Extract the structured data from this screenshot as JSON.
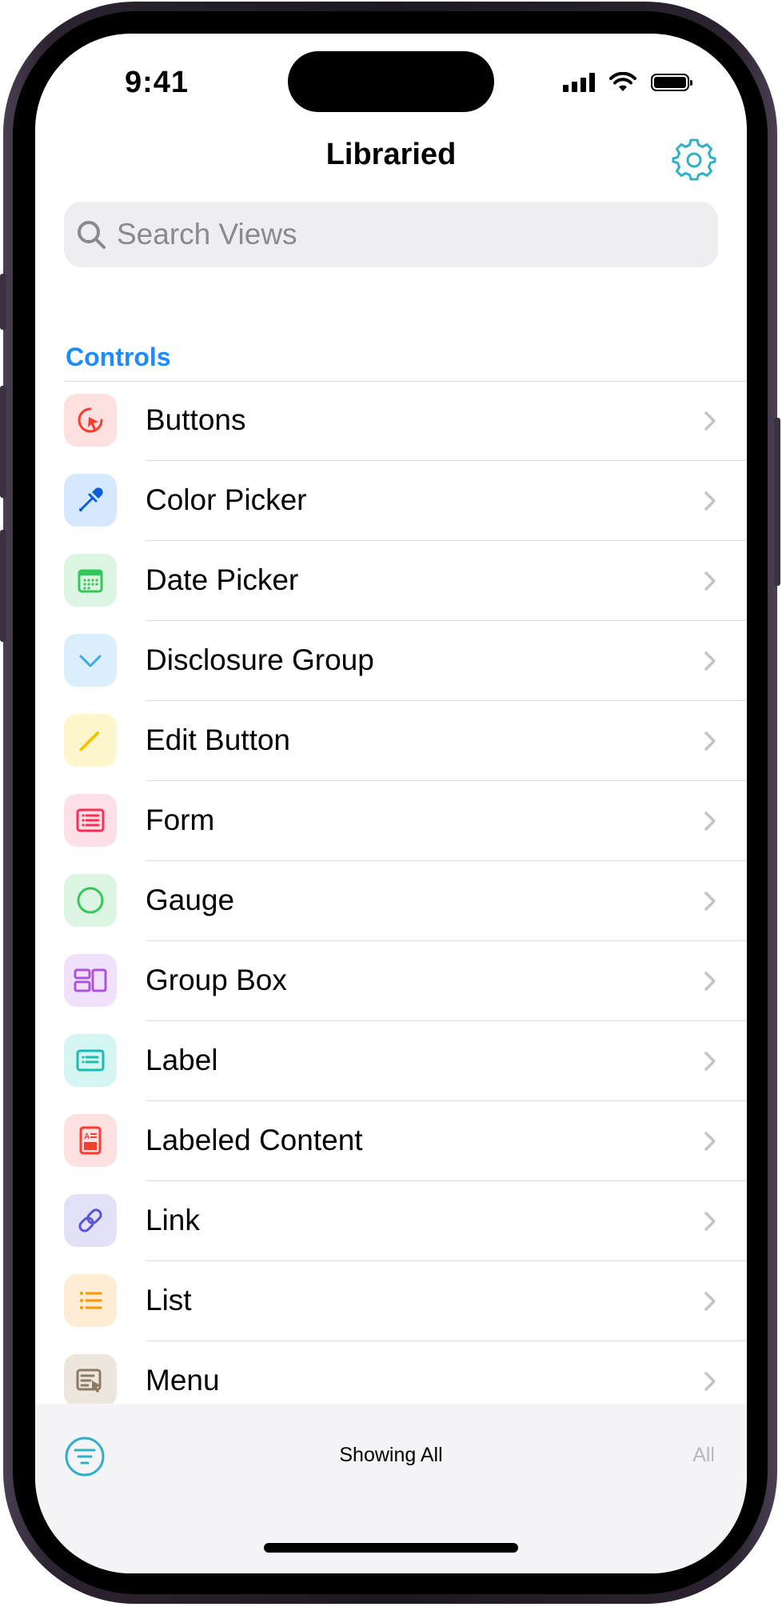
{
  "status_bar": {
    "time": "9:41"
  },
  "nav": {
    "title": "Libraried"
  },
  "search": {
    "placeholder": "Search Views",
    "value": ""
  },
  "section": {
    "title": "Controls"
  },
  "items": [
    {
      "label": "Buttons",
      "icon": "cursor-click-icon",
      "color": "#ff3b30",
      "bg": "#fde1e0"
    },
    {
      "label": "Color Picker",
      "icon": "eyedropper-icon",
      "color": "#0a60d6",
      "bg": "#d6e8fd"
    },
    {
      "label": "Date Picker",
      "icon": "calendar-icon",
      "color": "#34c759",
      "bg": "#dcf4e2"
    },
    {
      "label": "Disclosure Group",
      "icon": "chevron-down-icon",
      "color": "#32ade6",
      "bg": "#dbeefb"
    },
    {
      "label": "Edit Button",
      "icon": "pencil-icon",
      "color": "#f5c400",
      "bg": "#fdf6cc"
    },
    {
      "label": "Form",
      "icon": "form-icon",
      "color": "#ff2d55",
      "bg": "#fde0e6"
    },
    {
      "label": "Gauge",
      "icon": "circle-icon",
      "color": "#34c759",
      "bg": "#dcf4e2"
    },
    {
      "label": "Group Box",
      "icon": "group-box-icon",
      "color": "#af52de",
      "bg": "#f0e0fa"
    },
    {
      "label": "Label",
      "icon": "label-card-icon",
      "color": "#17bdb0",
      "bg": "#d5f5f3"
    },
    {
      "label": "Labeled Content",
      "icon": "labeled-content-icon",
      "color": "#ff3b30",
      "bg": "#fde1e0"
    },
    {
      "label": "Link",
      "icon": "link-icon",
      "color": "#5856d6",
      "bg": "#e2e1f8"
    },
    {
      "label": "List",
      "icon": "list-bullet-icon",
      "color": "#ff9500",
      "bg": "#feecd4"
    },
    {
      "label": "Menu",
      "icon": "menu-pointer-icon",
      "color": "#8e7a62",
      "bg": "#ede6dd"
    }
  ],
  "toolbar": {
    "status": "Showing All",
    "all_label": "All"
  },
  "colors": {
    "accent": "#1a8cff",
    "teal_accent": "#30b0c7"
  }
}
